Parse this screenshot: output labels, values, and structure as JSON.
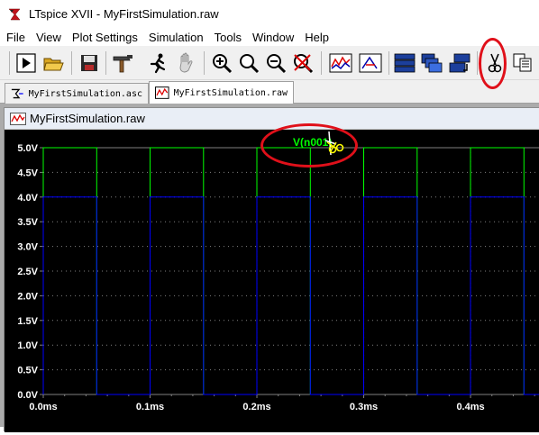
{
  "window": {
    "title": "LTspice XVII - MyFirstSimulation.raw"
  },
  "menu": [
    "File",
    "View",
    "Plot Settings",
    "Simulation",
    "Tools",
    "Window",
    "Help"
  ],
  "tabs": [
    {
      "label": "MyFirstSimulation.asc",
      "icon": "schematic-icon",
      "active": false
    },
    {
      "label": "MyFirstSimulation.raw",
      "icon": "waveform-icon",
      "active": true
    }
  ],
  "plot_window": {
    "title": "MyFirstSimulation.raw"
  },
  "toolbar": {
    "buttons": [
      "run-icon",
      "open-icon",
      "save-icon",
      "hammer-icon",
      "halt-icon",
      "hand-icon",
      "zoom-in-icon",
      "zoom-out-icon",
      "zoom-out-alt-icon",
      "autorange-icon",
      "plot-icon",
      "probe-icon",
      "tile-horizontal-icon",
      "cascade-icon",
      "tile-vertical-icon",
      "cut-icon",
      "copy-icon"
    ]
  },
  "chart_data": {
    "type": "line",
    "series": [
      {
        "name": "V(n001)",
        "color": "#00ff00",
        "points": [
          [
            0.0,
            4.0
          ],
          [
            0.0,
            5.0
          ],
          [
            0.05,
            5.0
          ],
          [
            0.05,
            0.0
          ],
          [
            0.1,
            0.0
          ],
          [
            0.1,
            5.0
          ],
          [
            0.15,
            5.0
          ],
          [
            0.15,
            0.0
          ],
          [
            0.2,
            0.0
          ],
          [
            0.2,
            5.0
          ],
          [
            0.25,
            5.0
          ],
          [
            0.25,
            0.0
          ],
          [
            0.3,
            0.0
          ],
          [
            0.3,
            5.0
          ],
          [
            0.35,
            5.0
          ],
          [
            0.35,
            0.0
          ],
          [
            0.4,
            0.0
          ],
          [
            0.4,
            5.0
          ],
          [
            0.45,
            5.0
          ],
          [
            0.45,
            0.0
          ],
          [
            0.5,
            0.0
          ],
          [
            0.5,
            5.0
          ]
        ]
      },
      {
        "color": "#0000ff",
        "points": [
          [
            0.0,
            0.0
          ],
          [
            0.0,
            4.0
          ],
          [
            0.05,
            4.0
          ],
          [
            0.05,
            0.0
          ],
          [
            0.1,
            0.0
          ],
          [
            0.1,
            4.0
          ],
          [
            0.15,
            4.0
          ],
          [
            0.15,
            0.0
          ],
          [
            0.2,
            0.0
          ],
          [
            0.2,
            4.0
          ],
          [
            0.25,
            4.0
          ],
          [
            0.25,
            0.0
          ],
          [
            0.3,
            0.0
          ],
          [
            0.3,
            4.0
          ],
          [
            0.35,
            4.0
          ],
          [
            0.35,
            0.0
          ],
          [
            0.4,
            0.0
          ],
          [
            0.4,
            4.0
          ],
          [
            0.45,
            4.0
          ],
          [
            0.45,
            0.0
          ],
          [
            0.5,
            0.0
          ],
          [
            0.5,
            4.0
          ]
        ]
      }
    ],
    "y_ticks": [
      "5.0V",
      "4.5V",
      "4.0V",
      "3.5V",
      "3.0V",
      "2.5V",
      "2.0V",
      "1.5V",
      "1.0V",
      "0.5V",
      "0.0V"
    ],
    "x_ticks": [
      "0.0ms",
      "0.1ms",
      "0.2ms",
      "0.3ms",
      "0.4ms"
    ],
    "ylim": [
      0,
      5
    ],
    "xlim": [
      0,
      0.47
    ],
    "grid": "dashed",
    "trace_label": "V(n001)",
    "trace_label_color": "#00ff00",
    "axis_color": "#808080",
    "tick_label_color": "#ffffff"
  },
  "annotations": {
    "color": "#e0101a"
  }
}
